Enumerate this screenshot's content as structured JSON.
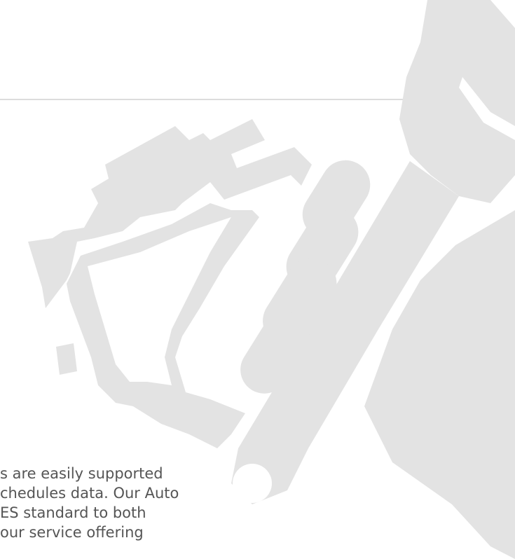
{
  "content": {
    "lines": [
      "s are easily supported",
      "chedules data. Our Auto",
      "ES standard to both",
      "our service offering"
    ]
  },
  "graphic": {
    "icon": "wrench-hand-engine-icon",
    "color": "#e3e3e3"
  },
  "divider_color": "#dcdcdc",
  "text_color": "#555555"
}
